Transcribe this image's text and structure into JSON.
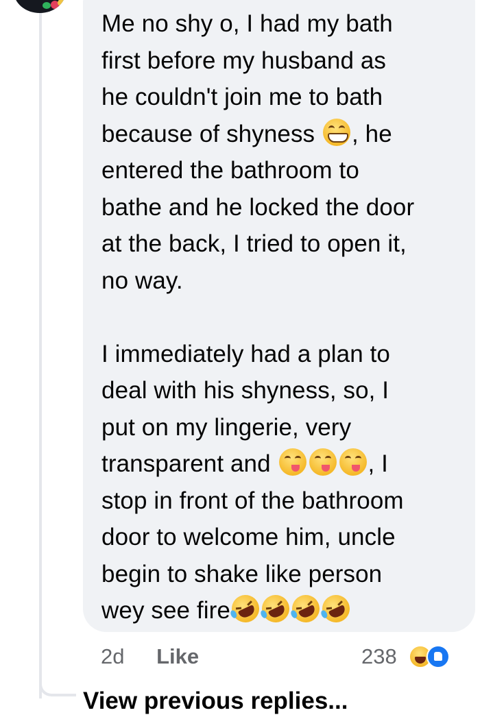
{
  "comment": {
    "avatar_icon": "avatar-icon",
    "paragraph1": {
      "part1": "Me no shy o, I had my bath\nfirst before my husband as\nhe couldn't join me to bath\nbecause of shyness ",
      "emoji1": "grinning-face-with-smiling-eyes",
      "part2": ", he\nentered the bathroom to\nbathe and he locked the door\nat the back, I tried to open it,\nno way."
    },
    "paragraph2": {
      "part1": "I immediately had a plan to\ndeal with his shyness, so, I\nput on my lingerie, very\ntransparent and ",
      "emoji_yum": "face-savoring-food",
      "part2": ", I\nstop in front of the bathroom\ndoor to welcome him, uncle\nbegin to shake like person\nwey see fire",
      "emoji_rofl": "rolling-on-the-floor-laughing"
    },
    "time": "2d",
    "like_label": "Like",
    "reaction_count": "238",
    "reaction_icons": [
      "haha-reaction-icon",
      "like-reaction-icon"
    ]
  },
  "view_previous_replies": "View previous replies..."
}
